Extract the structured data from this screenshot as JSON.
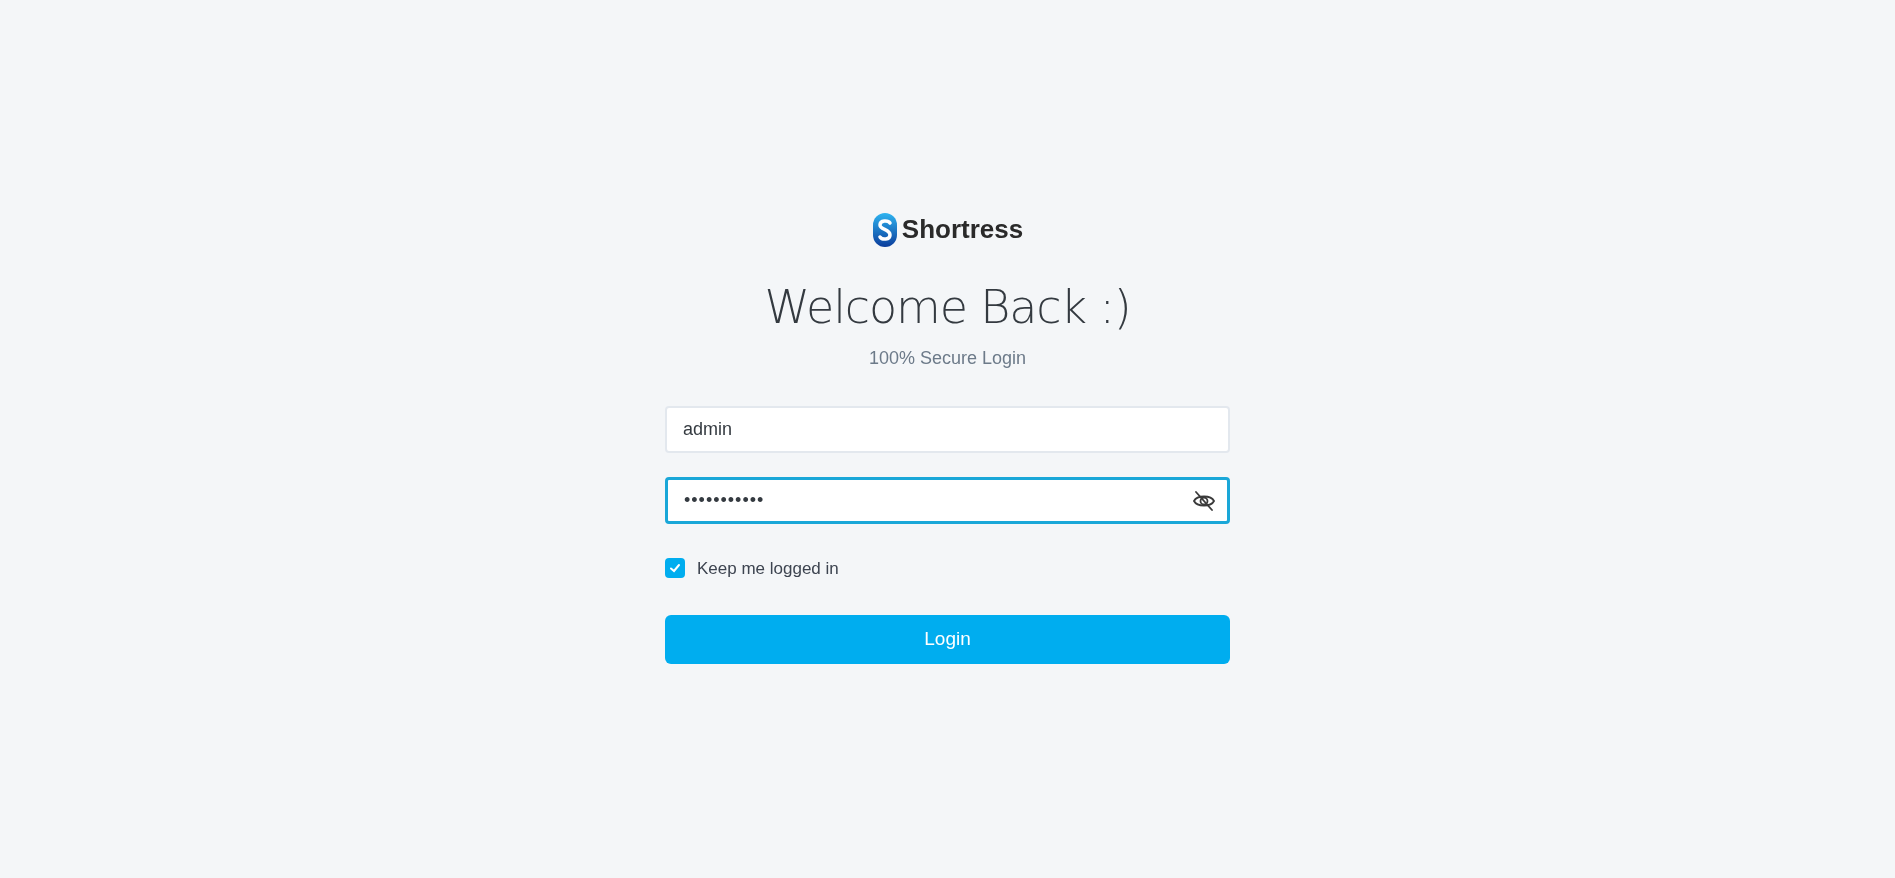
{
  "logo": {
    "text": "Shortress"
  },
  "heading": "Welcome Back :)",
  "subtitle": "100% Secure Login",
  "fields": [
    {
      "kind": "text",
      "value": "admin",
      "focused": false
    },
    {
      "kind": "password",
      "value": "•••••••••••",
      "focused": true
    }
  ],
  "remember": {
    "label": "Keep me logged in",
    "checked": true
  },
  "button": "Login"
}
